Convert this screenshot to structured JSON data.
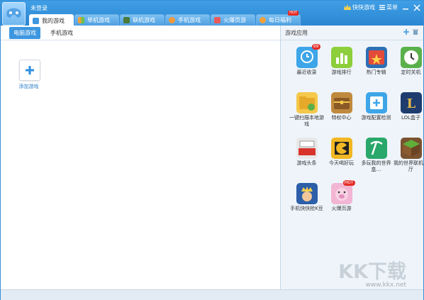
{
  "window": {
    "login_status": "未登录"
  },
  "tabs": [
    {
      "label": "我的游戏",
      "icon": "gamepad-icon",
      "active": true
    },
    {
      "label": "单机游戏",
      "icon": "grid-icon"
    },
    {
      "label": "联机游戏",
      "icon": "cube-icon"
    },
    {
      "label": "手机游戏",
      "icon": "phone-icon"
    },
    {
      "label": "火爆页游",
      "icon": "web-icon"
    },
    {
      "label": "每日福利",
      "icon": "gift-icon",
      "badge": "HOT"
    }
  ],
  "topright": {
    "brand": "快快游戏",
    "menu": "菜单"
  },
  "subtabs": [
    {
      "label": "电脑游戏",
      "active": true
    },
    {
      "label": "手机游戏"
    }
  ],
  "add_game_label": "添加游戏",
  "sidebar": {
    "title": "游戏应用",
    "apps": [
      {
        "label": "最近收录",
        "icon": "recent-icon",
        "badge": "99",
        "color": "#3ea6e8"
      },
      {
        "label": "游戏排行",
        "icon": "ranking-icon",
        "color": "#6fbf2e"
      },
      {
        "label": "热门专辑",
        "icon": "album-icon",
        "color": "#2d6fb5"
      },
      {
        "label": "定时关机",
        "icon": "timer-icon",
        "color": "#4aa84a"
      },
      {
        "label": "一键扫描本地游戏",
        "icon": "scan-folder-icon",
        "color": "#f0c04a"
      },
      {
        "label": "特权中心",
        "icon": "chest-icon",
        "color": "#b8823c"
      },
      {
        "label": "游戏配置检测",
        "icon": "config-check-icon",
        "color": "#3ea6e8"
      },
      {
        "label": "LOL盒子",
        "icon": "lol-icon",
        "color": "#1e3c6e"
      },
      {
        "label": "游戏头条",
        "icon": "game-news-icon",
        "color": "#d8d8d8"
      },
      {
        "label": "今天喝好玩",
        "icon": "pacman-icon",
        "color": "#f2b824"
      },
      {
        "label": "多玩我的世界盒…",
        "icon": "pickaxe-icon",
        "color": "#2aa76b"
      },
      {
        "label": "我的世界联机大厅",
        "icon": "grass-block-icon",
        "color": "#5b8c3a"
      },
      {
        "label": "手机快快抢K豆",
        "icon": "king-icon",
        "color": "#2d5fa8"
      },
      {
        "label": "火爆页游",
        "icon": "pig-icon",
        "color": "#e58fc0",
        "badge": "HOT"
      }
    ]
  },
  "watermark": {
    "logo": "KK下载",
    "url": "www.kkx.net"
  }
}
